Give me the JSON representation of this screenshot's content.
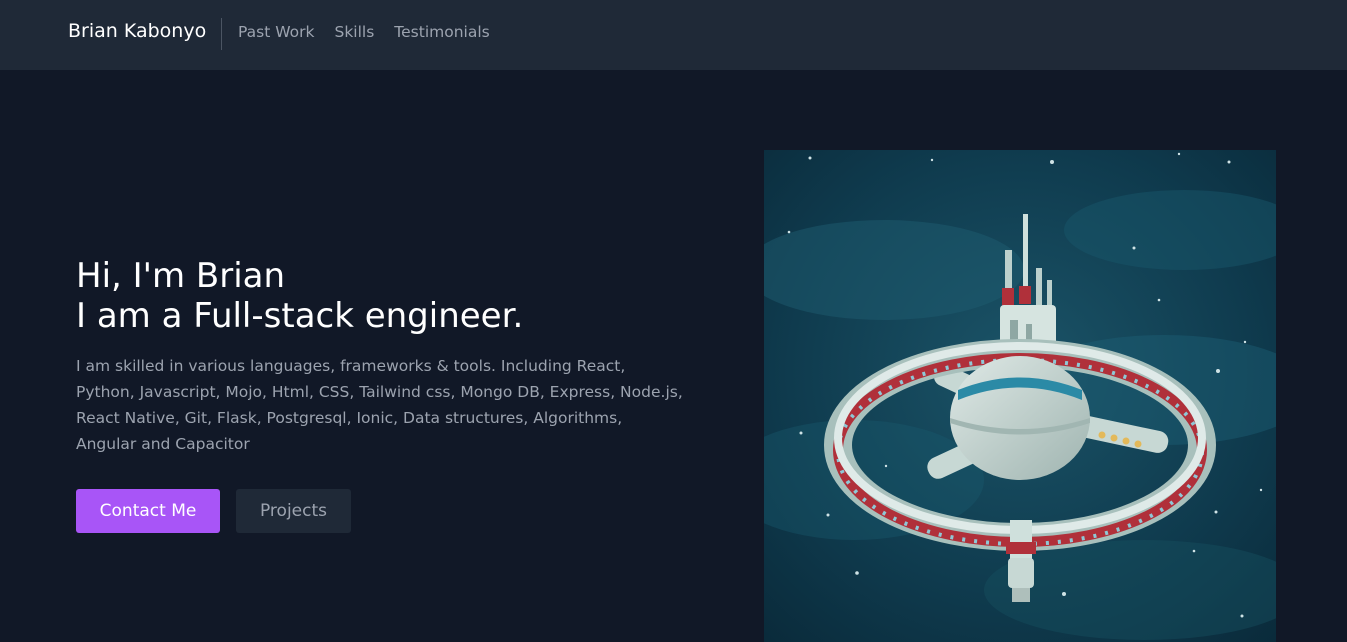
{
  "header": {
    "brand": "Brian Kabonyo",
    "nav": [
      "Past Work",
      "Skills",
      "Testimonials"
    ]
  },
  "hero": {
    "title_line1": "Hi, I'm Brian",
    "title_line2": "I am a Full-stack engineer.",
    "description": "I am skilled in various languages, frameworks & tools. Including React, Python, Javascript, Mojo, Html, CSS, Tailwind css, Mongo DB, Express, Node.js, React Native, Git, Flask, Postgresql, Ionic, Data structures, Algorithms, Angular and Capacitor",
    "primary_button": "Contact Me",
    "secondary_button": "Projects",
    "image": "space-station-illustration"
  },
  "colors": {
    "background": "#111827",
    "header": "#1f2937",
    "accent": "#a855f7",
    "text_muted": "#9ca3af"
  }
}
